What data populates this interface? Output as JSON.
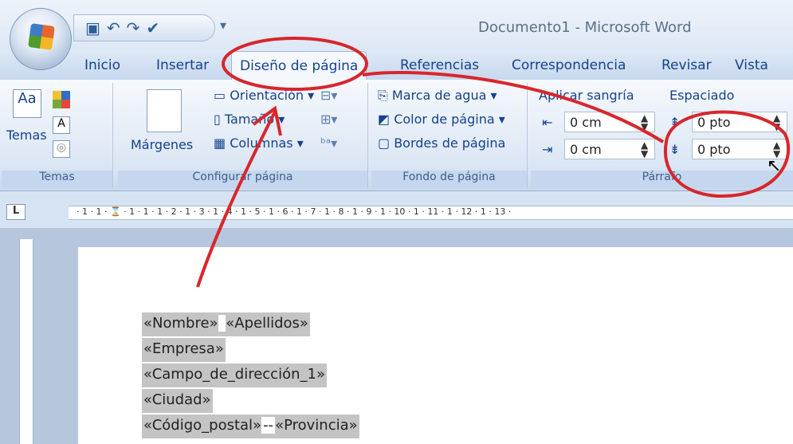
{
  "window": {
    "title": "Documento1 - Microsoft Word"
  },
  "tabs": [
    "Inicio",
    "Insertar",
    "Diseño de página",
    "Referencias",
    "Correspondencia",
    "Revisar",
    "Vista"
  ],
  "active_tab": "Diseño de página",
  "ribbon": {
    "temas": {
      "button_label": "Temas",
      "group_label": "Temas",
      "icons": [
        "themes-icon",
        "colors-icon",
        "fonts-icon",
        "effects-icon"
      ]
    },
    "configurar_pagina": {
      "margenes_label": "Márgenes",
      "orientacion_label": "Orientación",
      "tamano_label": "Tamaño",
      "columnas_label": "Columnas",
      "group_label": "Configurar página"
    },
    "fondo_pagina": {
      "marca_agua_label": "Marca de agua",
      "color_pagina_label": "Color de página",
      "bordes_pagina_label": "Bordes de página",
      "group_label": "Fondo de página"
    },
    "parrafo": {
      "sangria_header": "Aplicar sangría",
      "sangria_izq_value": "0 cm",
      "sangria_der_value": "0 cm",
      "espaciado_header": "Espaciado",
      "espaciado_antes_value": "0 pto",
      "espaciado_despues_value": "0 pto",
      "group_label": "Párrafo"
    }
  },
  "ruler": {
    "ticks": "· 1 · 1 · ⌛ · 1 · 1 · 1 · 2 · 1 · 3 · 1 · 4 · 1 · 5 · 1 · 6 · 1 · 7 · 1 · 8 · 1 · 9 · 1 · 10 · 1 · 11 · 1 · 12 · 1 · 13 ·",
    "corner_label": "L"
  },
  "document": {
    "fields": [
      [
        "«Nombre»",
        "«Apellidos»"
      ],
      [
        "«Empresa»"
      ],
      [
        "«Campo_de_dirección_1»"
      ],
      [
        "«Ciudad»"
      ],
      [
        "«Código_postal»",
        "«Provincia»"
      ]
    ],
    "separator_line5": "--"
  },
  "colors": {
    "annotation": "#d8262c",
    "ribbon_text": "#15428b",
    "field_highlight": "#c4c4c4"
  }
}
